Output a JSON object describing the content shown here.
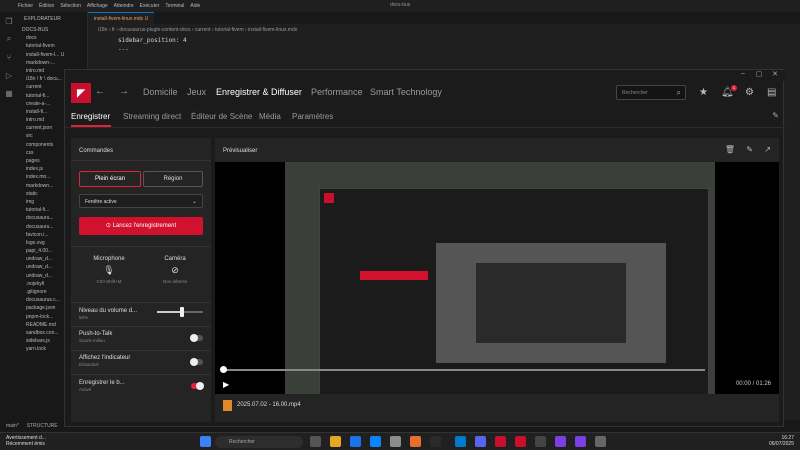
{
  "vscode": {
    "menu": [
      "Fichier",
      "Édition",
      "Sélection",
      "Affichage",
      "Atteindre",
      "Exécuter",
      "Terminal",
      "Aide"
    ],
    "window_title": "docs-bus",
    "explorer_title": "EXPLORATEUR",
    "explorer_root": "DOCS-BUS",
    "explorer_rows": [
      "docs",
      "tutorial-fivem",
      "install-fivem-l... U",
      "markdown-...",
      "intro.md",
      "i18n \\ fr \\ docu...",
      "current",
      "tutorial-fi...",
      "create-a-...",
      "install-fi...",
      "intro.md",
      "current.json",
      "src",
      "components",
      "css",
      "pages",
      "index.js",
      "index.mo...",
      "markdown...",
      "static",
      "img",
      "tutorial-fi...",
      "docusauru...",
      "docusauru...",
      "favicon.i...",
      "logo.svg",
      "papi_4.00...",
      "undraw_d...",
      "undraw_d...",
      "undraw_d...",
      ".nojekyll",
      ".gitignore",
      "docusaurus.c...",
      "package.json",
      "pnpm-lock...",
      "README.md",
      "sandbox.con...",
      "sidebars.js",
      "yarn.lock"
    ],
    "explorer_sections": [
      "STRUCTURE",
      "CHRONOLOGIE"
    ],
    "tab": "install-fivem-linux.mdx U",
    "breadcrumb": "i18n › fr › docusaurus-plugin-content-docs › current › tutorial-fivem › install-fivem-linux.mdx",
    "code_lines": [
      "sidebar_position: 4",
      "---"
    ],
    "status_branch": "main*"
  },
  "amd": {
    "nav": {
      "tabs": [
        "Domicile",
        "Jeux",
        "Enregistrer & Diffuser",
        "Performance",
        "Smart Technology"
      ],
      "active_tab": "Enregistrer & Diffuser",
      "search_placeholder": "Rechercher",
      "notification_count": "1"
    },
    "subnav": {
      "tabs": [
        "Enregistrer",
        "Streaming direct",
        "Éditeur de Scène",
        "Média",
        "Paramètres"
      ],
      "active_tab": "Enregistrer"
    },
    "commands": {
      "title": "Commandes",
      "full_screen": "Plein écran",
      "region": "Région",
      "window_select": "Fenêtre active",
      "record_button": "Lancez l'enregistrement",
      "mic_label": "Microphone",
      "mic_shortcut": "Ctrl+Shift+M",
      "camera_label": "Caméra",
      "camera_status": "Non détecté",
      "volume_label": "Niveau du volume d...",
      "volume_value": "50%",
      "volume_level": 0.55,
      "ptt_label": "Push-to-Talk",
      "ptt_sub": "Souris milieu",
      "ptt_on": false,
      "indicator_label": "Affichez l'indicateur",
      "indicator_sub": "Désactivé",
      "indicator_on": false,
      "record_b_label": "Enregistrer le b...",
      "record_b_sub": "Activé",
      "record_b_on": true
    },
    "preview": {
      "title": "Prévisualiser",
      "time": "00:00 / 01:26",
      "file_name": "2025.07.02 - 16.00.mp4",
      "progress": 0.0
    }
  },
  "taskbar": {
    "notif_title": "Avertissement d...",
    "notif_sub": "Récemment émis",
    "search": "Rechercher",
    "time": "16:27",
    "date": "06/07/2025"
  },
  "colors": {
    "accent": "#e0223a",
    "amd_red": "#c8102e",
    "bg": "#1b1b1b"
  }
}
